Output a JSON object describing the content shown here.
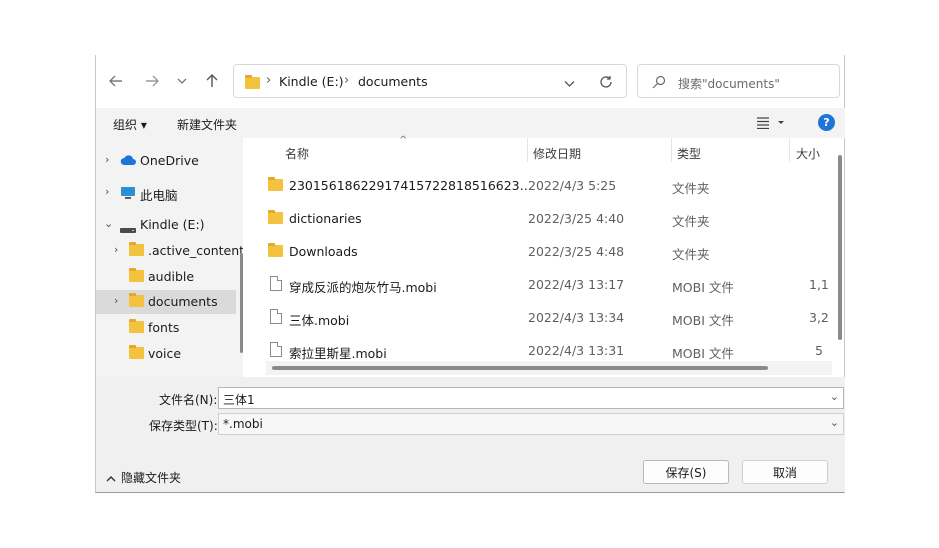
{
  "nav": {
    "back": "←",
    "forward": "→",
    "recent": "⌄",
    "up": "↑"
  },
  "address": {
    "path": [
      "Kindle (E:)",
      "documents"
    ],
    "separator": "›"
  },
  "search": {
    "placeholder": "搜索\"documents\""
  },
  "toolbar": {
    "organize": "组织 ▾",
    "new_folder": "新建文件夹",
    "help": "?"
  },
  "navpane": {
    "items": [
      {
        "label": "OneDrive"
      },
      {
        "label": "此电脑"
      },
      {
        "label": "Kindle (E:)"
      },
      {
        "label": ".active_content"
      },
      {
        "label": "audible"
      },
      {
        "label": "documents"
      },
      {
        "label": "fonts"
      },
      {
        "label": "voice"
      }
    ]
  },
  "filelist": {
    "columns": [
      "名称",
      "修改日期",
      "类型",
      "大小"
    ],
    "rows": [
      {
        "name": "23015618622917415722818516623…",
        "date": "2022/4/3 5:25",
        "type": "文件夹",
        "size": ""
      },
      {
        "name": "dictionaries",
        "date": "2022/3/25 4:40",
        "type": "文件夹",
        "size": ""
      },
      {
        "name": "Downloads",
        "date": "2022/3/25 4:48",
        "type": "文件夹",
        "size": ""
      },
      {
        "name": "穿成反派的炮灰竹马.mobi",
        "date": "2022/4/3 13:17",
        "type": "MOBI 文件",
        "size": "1,1"
      },
      {
        "name": "三体.mobi",
        "date": "2022/4/3 13:34",
        "type": "MOBI 文件",
        "size": "3,2"
      },
      {
        "name": "索拉里斯星.mobi",
        "date": "2022/4/3 13:31",
        "type": "MOBI 文件",
        "size": "5"
      }
    ]
  },
  "form": {
    "filename_label": "文件名(N):",
    "filename_value": "三体1",
    "filetype_label": "保存类型(T):",
    "filetype_value": "*.mobi",
    "hide_folders": "隐藏文件夹",
    "save": "保存(S)",
    "cancel": "取消"
  },
  "colors": {
    "accent": "#1f74d9",
    "folder": "#f3c23f",
    "panel": "#f3f3f3",
    "selected": "#dadada"
  }
}
